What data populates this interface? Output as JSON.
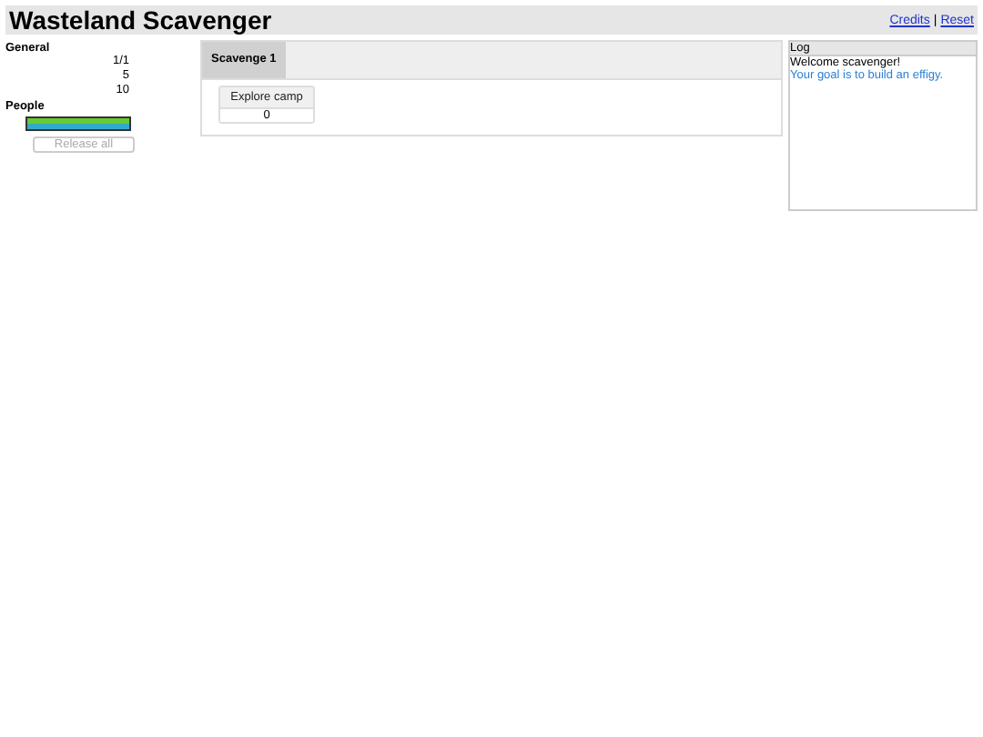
{
  "header": {
    "title": "Wasteland Scavenger",
    "links": [
      "Credits",
      "Reset"
    ],
    "separator": "|"
  },
  "sidebar": {
    "general_title": "General",
    "general_values": [
      "1/1",
      "5",
      "10"
    ],
    "people_title": "People",
    "people_bars": [
      {
        "color": "#66cc33",
        "level": 1
      },
      {
        "color": "#33aacc",
        "level": 1
      }
    ],
    "release_button": {
      "label": "Release all",
      "disabled": true
    }
  },
  "tabs": [
    {
      "label": "Scavenge 1",
      "selected": true
    }
  ],
  "actions": [
    {
      "label": "Explore camp",
      "count": "0"
    }
  ],
  "log": {
    "title": "Log",
    "entries": [
      {
        "text": "Welcome scavenger!",
        "color": "#000000"
      },
      {
        "text": "Your goal is to build an effigy.",
        "color": "#2a7fd4"
      }
    ]
  }
}
